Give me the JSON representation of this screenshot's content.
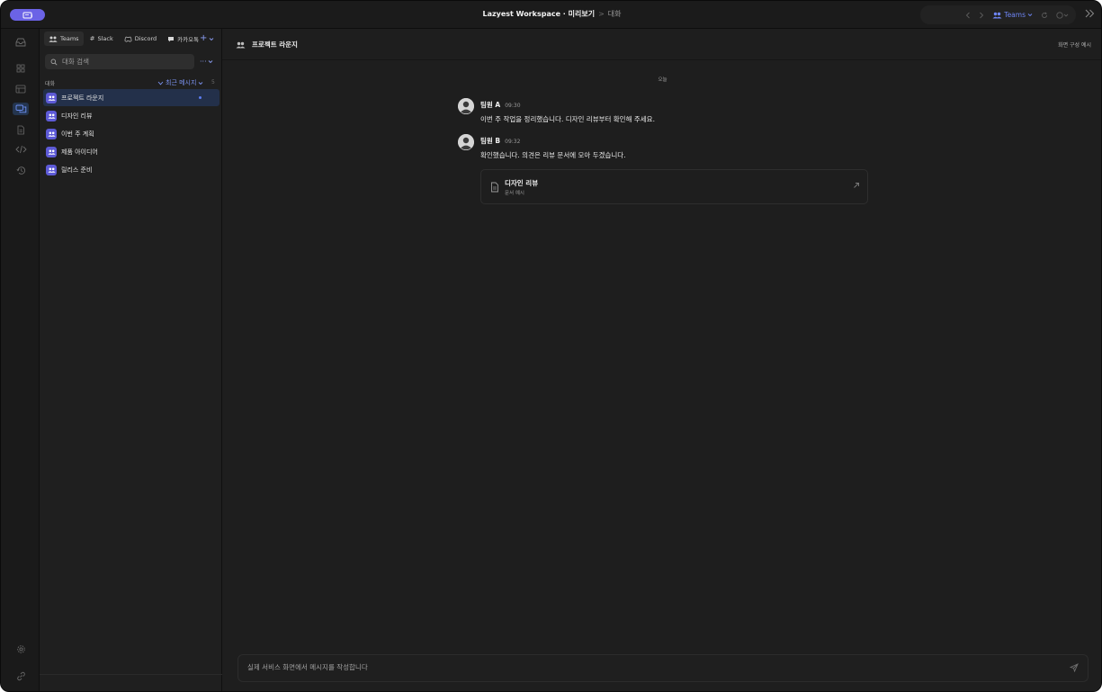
{
  "titlebar": {
    "workspace": "Lazyest Workspace · 미리보기",
    "separator": ">",
    "crumb": "대화",
    "platform_select": "Teams",
    "icons": [
      "app-window-icon",
      "back-icon",
      "forward-icon",
      "people-icon",
      "refresh-icon",
      "user-menu-icon",
      "collapse-double-chevron-icon"
    ]
  },
  "rail": {
    "items": [
      "inbox-icon",
      "dashboard-icon",
      "list-icon",
      "chat-icon",
      "document-icon",
      "code-icon",
      "history-icon"
    ],
    "active": "chat-icon",
    "bottom": [
      "settings-icon",
      "link-icon"
    ]
  },
  "sidebar": {
    "platform_tabs": [
      {
        "label": "Teams",
        "icon": "people-icon",
        "active": true
      },
      {
        "label": "Slack",
        "icon": "hash-icon",
        "active": false
      },
      {
        "label": "Discord",
        "icon": "discord-icon",
        "active": false
      },
      {
        "label": "카카오톡",
        "icon": "speech-bubble-icon",
        "active": false
      }
    ],
    "add_label": "+",
    "search_placeholder": "대화 검색",
    "more_label": "···",
    "section_label": "대화",
    "sort_label": "최근 메시지",
    "count": "5",
    "conversations": [
      {
        "name": "프로젝트 라운지",
        "active": true,
        "unread": true
      },
      {
        "name": "디자인 리뷰",
        "active": false,
        "unread": false
      },
      {
        "name": "이번 주 계획",
        "active": false,
        "unread": false
      },
      {
        "name": "제품 아이디어",
        "active": false,
        "unread": false
      },
      {
        "name": "릴리스 준비",
        "active": false,
        "unread": false
      }
    ]
  },
  "chat": {
    "title": "프로젝트 라운지",
    "config_label": "화면 구성 예시",
    "day_separator": "오늘",
    "messages": [
      {
        "author": "팀원 A",
        "time": "09:30",
        "text": "이번 주 작업을 정리했습니다. 디자인 리뷰부터 확인해 주세요."
      },
      {
        "author": "팀원 B",
        "time": "09:32",
        "text": "확인했습니다. 의견은 리뷰 문서에 모아 두겠습니다."
      }
    ],
    "attachment": {
      "title": "디자인 리뷰",
      "subtitle": "문서 예시"
    },
    "composer_placeholder": "실제 서비스 화면에서 메시지를 작성합니다"
  },
  "colors": {
    "accent": "#6b63e6",
    "link": "#7b93f2",
    "background": "#1e1e1e"
  }
}
